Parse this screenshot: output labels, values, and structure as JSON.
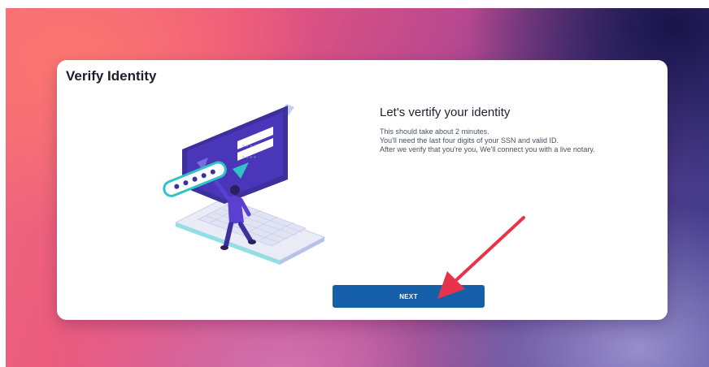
{
  "card": {
    "title": "Verify Identity",
    "heading": "Let's vertify your identity",
    "lines": [
      "This should take about 2 minutes.",
      "You'll need the last four digits of your SSN and valid ID.",
      "After we verify that you're you, We'll connect you with a live notary."
    ],
    "next_label": "NEXT"
  },
  "illustration": {
    "icon": "laptop-identity-illustration",
    "accent": "#5b3fd1",
    "screen": "#3d2f9c",
    "teal": "#2fc3c8"
  },
  "annotation": {
    "icon": "red-arrow-pointer",
    "color": "#e8344a"
  }
}
